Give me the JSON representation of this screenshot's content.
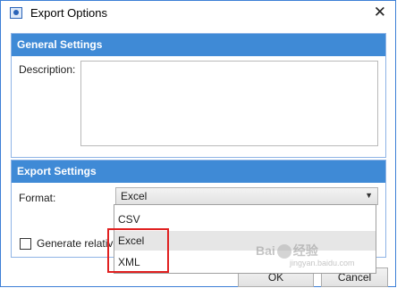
{
  "window": {
    "title": "Export Options",
    "close_glyph": "✕"
  },
  "general_settings": {
    "header": "General Settings",
    "description_label": "Description:",
    "description_value": ""
  },
  "export_settings": {
    "header": "Export Settings",
    "format_label": "Format:",
    "format_value": "Excel",
    "format_arrow": "▼",
    "format_options": [
      "CSV",
      "Excel",
      "XML"
    ],
    "highlighted_option": "Excel",
    "generate_checkbox_label": "Generate relative",
    "generate_checked": false
  },
  "buttons": {
    "ok": "OK",
    "cancel": "Cancel"
  },
  "watermark": {
    "text_left": "Bai",
    "text_right": "经验",
    "subtext": "jingyan.baidu.com"
  },
  "colors": {
    "header_bg": "#3f8ad6",
    "highlight_box": "#e02020"
  },
  "icons": {
    "app": "export-window-icon",
    "close": "close-icon",
    "dropdown": "chevron-down-icon"
  }
}
